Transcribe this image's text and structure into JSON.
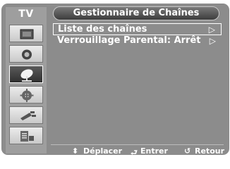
{
  "menu": {
    "section_label": "TV",
    "title": "Gestionnaire de Chaînes",
    "items": [
      {
        "label": "Liste des chaînes",
        "arrow": "▷"
      },
      {
        "label": "Verrouillage Parental: Arrêt",
        "arrow": "▷"
      }
    ]
  },
  "sidebar": {
    "icons": [
      "picture-icon",
      "sound-icon",
      "satellite-dish-icon",
      "gear-icon",
      "plug-icon",
      "input-list-icon"
    ],
    "selected_index": 2
  },
  "footer": {
    "move_symbol": "⬍",
    "move_label": "Déplacer",
    "enter_symbol": "⮐",
    "enter_label": "Entrer",
    "return_symbol": "↺",
    "return_label": "Retour"
  }
}
